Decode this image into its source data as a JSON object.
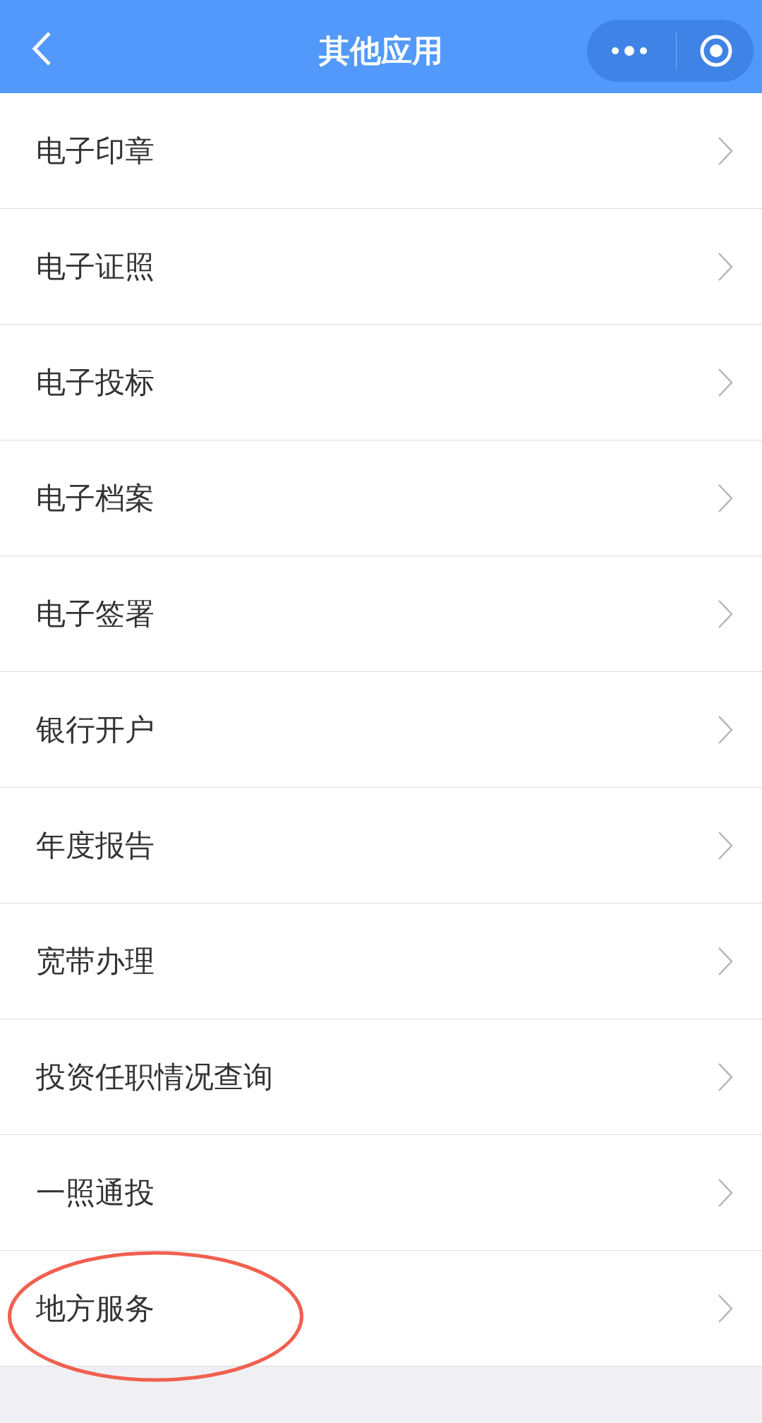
{
  "header": {
    "title": "其他应用"
  },
  "items": [
    {
      "label": "电子印章",
      "highlighted": false
    },
    {
      "label": "电子证照",
      "highlighted": false
    },
    {
      "label": "电子投标",
      "highlighted": false
    },
    {
      "label": "电子档案",
      "highlighted": false
    },
    {
      "label": "电子签署",
      "highlighted": false
    },
    {
      "label": "银行开户",
      "highlighted": false
    },
    {
      "label": "年度报告",
      "highlighted": false
    },
    {
      "label": "宽带办理",
      "highlighted": false
    },
    {
      "label": "投资任职情况查询",
      "highlighted": false
    },
    {
      "label": "一照通投",
      "highlighted": false
    },
    {
      "label": "地方服务",
      "highlighted": true
    }
  ]
}
